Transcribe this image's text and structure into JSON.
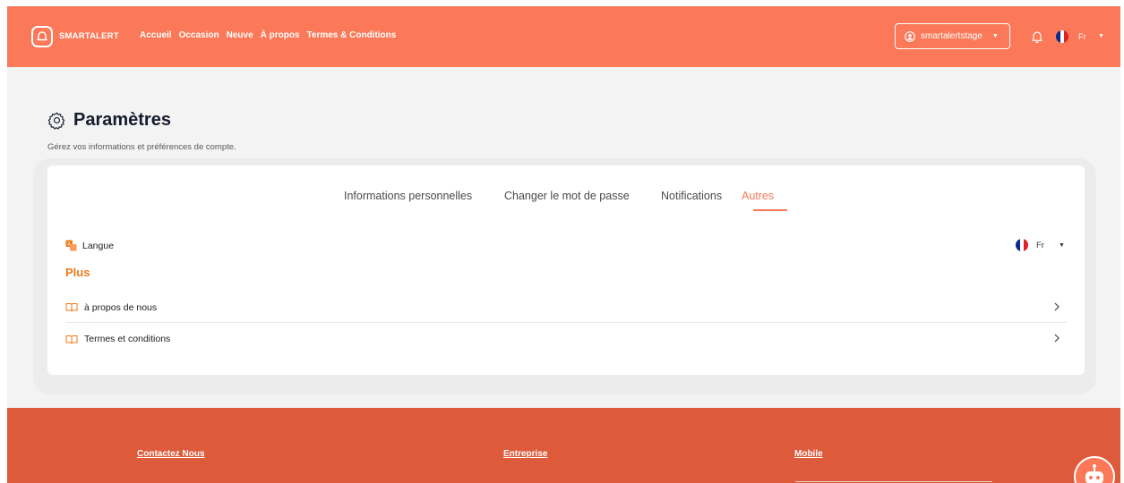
{
  "colors": {
    "brand": "#fb7858",
    "footer": "#dd5a3a",
    "accent_orange": "#f07a18",
    "active_tab": "#fb7858"
  },
  "navbar": {
    "brand": "SMARTALERT",
    "links": [
      "Accueil",
      "Occasion",
      "Neuve",
      "À propos",
      "Termes & Conditions"
    ],
    "username": "smartalertstage",
    "language": "Fr",
    "icons": {
      "logo": "bell-logo-icon",
      "user": "user-circle-icon",
      "notifications": "bell-icon",
      "flag": "france-flag-icon"
    }
  },
  "page": {
    "title": "Paramètres",
    "subtitle": "Gérez vos informations et préférences de compte.",
    "title_icon": "gear-icon"
  },
  "tabs": [
    {
      "label": "Informations personnelles"
    },
    {
      "label": "Changer le mot de passe"
    },
    {
      "label": "Notifications"
    },
    {
      "label": "Autres",
      "active": true
    }
  ],
  "other_settings": {
    "language_label": "Langue",
    "language_value": "Fr",
    "section_title": "Plus",
    "items": [
      {
        "label": "à propos de nous",
        "icon": "book-icon"
      },
      {
        "label": "Termes et conditions",
        "icon": "book-icon"
      }
    ]
  },
  "footer": {
    "columns": [
      "Contactez Nous",
      "Entreprise",
      "Mobile"
    ]
  }
}
